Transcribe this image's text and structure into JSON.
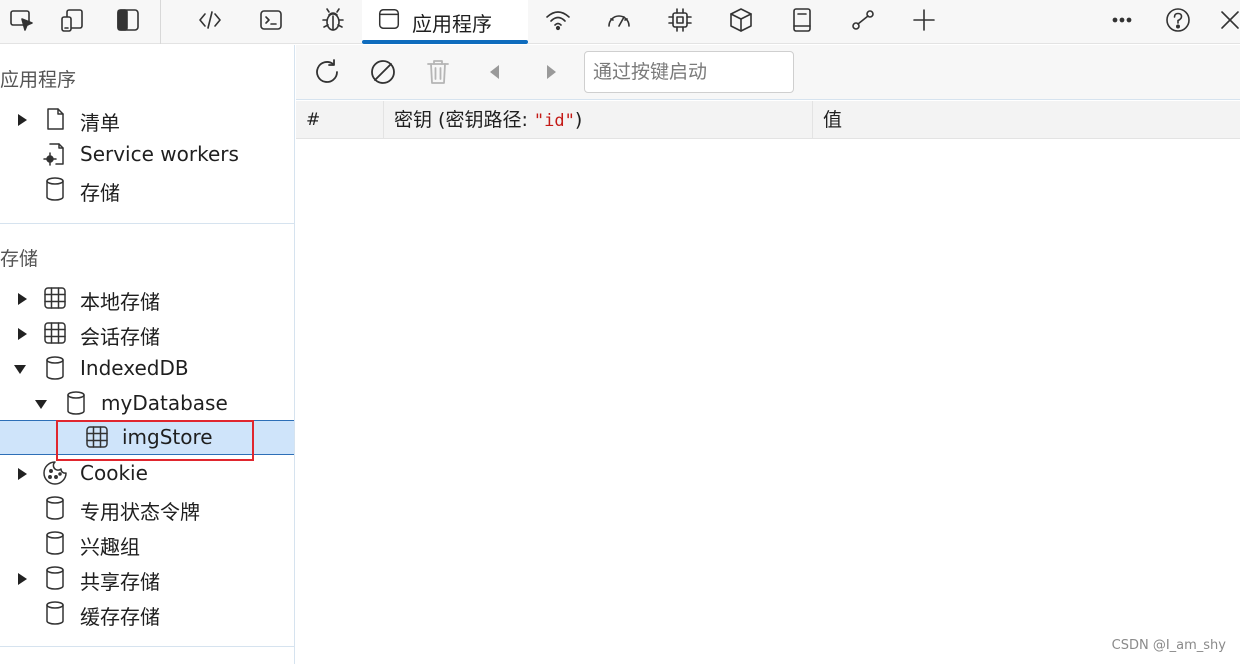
{
  "topbar": {
    "active_tab_label": "应用程序",
    "icons": [
      "inspect-icon",
      "device-emulation-icon",
      "dock-toggle-icon",
      "elements-icon",
      "console-icon",
      "sources-icon",
      "application-icon",
      "network-icon",
      "performance-icon",
      "memory-icon",
      "3d-view-icon",
      "welcome-icon",
      "more-tools-icon",
      "add-icon",
      "more-options-icon",
      "help-icon",
      "close-icon"
    ]
  },
  "sidebar": {
    "app_section_title": "应用程序",
    "app_items": [
      {
        "label": "清单",
        "icon": "page-icon",
        "expandable": true
      },
      {
        "label": "Service workers",
        "icon": "gear-page-icon",
        "expandable": false
      },
      {
        "label": "存储",
        "icon": "database-icon",
        "expandable": false
      }
    ],
    "storage_section_title": "存储",
    "storage_items": [
      {
        "label": "本地存储",
        "icon": "grid-icon",
        "expandable": true,
        "expanded": false
      },
      {
        "label": "会话存储",
        "icon": "grid-icon",
        "expandable": true,
        "expanded": false
      },
      {
        "label": "IndexedDB",
        "icon": "database-icon",
        "expandable": true,
        "expanded": true
      },
      {
        "label": "myDatabase",
        "icon": "database-icon",
        "expandable": true,
        "expanded": true
      },
      {
        "label": "imgStore",
        "icon": "grid-icon",
        "expandable": false,
        "selected": true
      },
      {
        "label": "Cookie",
        "icon": "cookie-icon",
        "expandable": true,
        "expanded": false
      },
      {
        "label": "专用状态令牌",
        "icon": "database-icon",
        "expandable": false
      },
      {
        "label": "兴趣组",
        "icon": "database-icon",
        "expandable": false
      },
      {
        "label": "共享存储",
        "icon": "database-icon",
        "expandable": true,
        "expanded": false
      },
      {
        "label": "缓存存储",
        "icon": "database-icon",
        "expandable": false
      }
    ]
  },
  "toolbar": {
    "search_placeholder": "通过按键启动"
  },
  "table": {
    "col_hash": "#",
    "col_key_prefix": "密钥 (密钥路径: ",
    "col_key_path": "\"id\"",
    "col_key_suffix": ")",
    "col_value": "值",
    "rows": []
  },
  "watermark": "CSDN @I_am_shy",
  "colors": {
    "accent": "#0f6cbd",
    "selection": "#cfe4fa",
    "highlight_border": "#e0262e"
  }
}
